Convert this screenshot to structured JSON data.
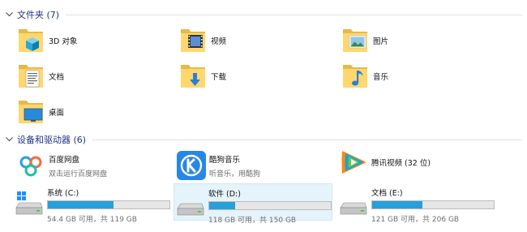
{
  "folders_group": {
    "title": "文件夹 (7)",
    "items": [
      {
        "label": "3D 对象",
        "icon": "3d-objects-folder-icon"
      },
      {
        "label": "视频",
        "icon": "videos-folder-icon"
      },
      {
        "label": "图片",
        "icon": "pictures-folder-icon"
      },
      {
        "label": "文档",
        "icon": "documents-folder-icon"
      },
      {
        "label": "下载",
        "icon": "downloads-folder-icon"
      },
      {
        "label": "音乐",
        "icon": "music-folder-icon"
      },
      {
        "label": "桌面",
        "icon": "desktop-folder-icon"
      }
    ]
  },
  "devices_group": {
    "title": "设备和驱动器 (6)",
    "apps": [
      {
        "name": "百度网盘",
        "sub": "双击运行百度网盘",
        "icon": "baidu-netdisk-icon"
      },
      {
        "name": "酷狗音乐",
        "sub": "听音乐，用酷狗",
        "icon": "kugou-music-icon"
      },
      {
        "name": "腾讯视频 (32 位)",
        "sub": "",
        "icon": "tencent-video-icon"
      }
    ],
    "drives": [
      {
        "name": "系统 (C:)",
        "free_text": "54.4 GB 可用，共 119 GB",
        "used_fraction": 0.543,
        "selected": false,
        "icon": "windows-drive-icon"
      },
      {
        "name": "软件 (D:)",
        "free_text": "118 GB 可用，共 150 GB",
        "used_fraction": 0.213,
        "selected": true,
        "icon": "drive-icon"
      },
      {
        "name": "文档 (E:)",
        "free_text": "121 GB 可用，共 206 GB",
        "used_fraction": 0.413,
        "selected": false,
        "icon": "drive-icon"
      }
    ]
  },
  "colors": {
    "header_text": "#1e3287",
    "bar_fill": "#26a0da",
    "selection_bg": "#e5f3fb"
  }
}
